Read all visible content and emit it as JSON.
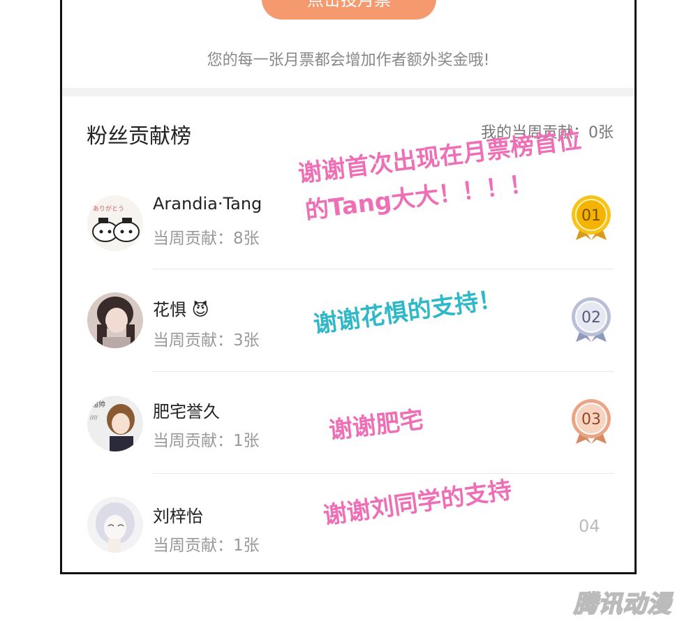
{
  "top": {
    "vote_button_label": "点击投月票",
    "note": "您的每一张月票都会增加作者额外奖金哦!"
  },
  "board": {
    "title": "粉丝贡献榜",
    "my_contribution": "我的当周贡献：0张"
  },
  "fans": [
    {
      "name": "Arandia·Tang",
      "contribution": "当周贡献：8张",
      "rank": "01",
      "medal_color": "#f2b705"
    },
    {
      "name": "花惧",
      "emoji": "😈",
      "contribution": "当周贡献：3张",
      "rank": "02",
      "medal_color": "#9ea7c4"
    },
    {
      "name": "肥宅誉久",
      "contribution": "当周贡献：1张",
      "rank": "03",
      "medal_color": "#e8a07a"
    },
    {
      "name": "刘梓怡",
      "contribution": "当周贡献：1张",
      "rank": "04"
    }
  ],
  "annotations": [
    {
      "text": "谢谢首次出现在月票榜首位",
      "color": "#ee6fb5"
    },
    {
      "text": "的Tang大大！！！！",
      "color": "#ee6fb5"
    },
    {
      "text": "谢谢花惧的支持！",
      "color": "#2fb8c8"
    },
    {
      "text": "谢谢肥宅",
      "color": "#ee6fb5"
    },
    {
      "text": "谢谢刘同学的支持",
      "color": "#ee6fb5"
    }
  ],
  "watermark": "腾讯动漫"
}
